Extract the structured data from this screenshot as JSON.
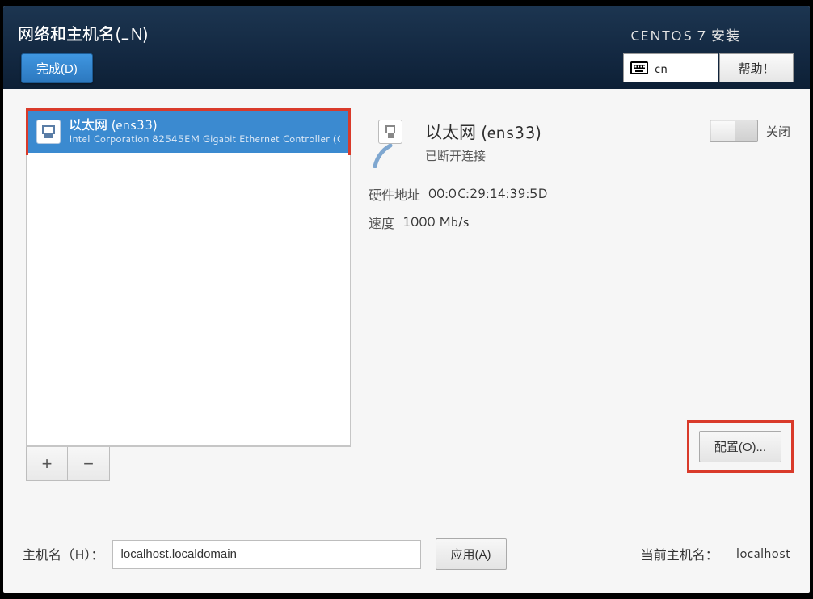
{
  "header": {
    "page_title": "网络和主机名(_N)",
    "done_label": "完成(D)",
    "banner": "CENTOS 7 安装",
    "keyboard_layout": "cn",
    "help_label": "帮助！"
  },
  "device_list": {
    "items": [
      {
        "name": "以太网 (ens33)",
        "description": "Intel Corporation 82545EM Gigabit Ethernet Controller (C"
      }
    ],
    "add_label": "+",
    "remove_label": "−"
  },
  "detail": {
    "title": "以太网 (ens33)",
    "status": "已断开连接",
    "toggle_state_label": "关闭",
    "hw_addr_key": "硬件地址",
    "hw_addr_val": "00:0C:29:14:39:5D",
    "speed_key": "速度",
    "speed_val": "1000 Mb/s",
    "configure_label": "配置(O)..."
  },
  "hostname": {
    "label": "主机名（H）：",
    "value": "localhost.localdomain",
    "apply_label": "应用(A)",
    "current_label": "当前主机名：",
    "current_value": "localhost"
  }
}
